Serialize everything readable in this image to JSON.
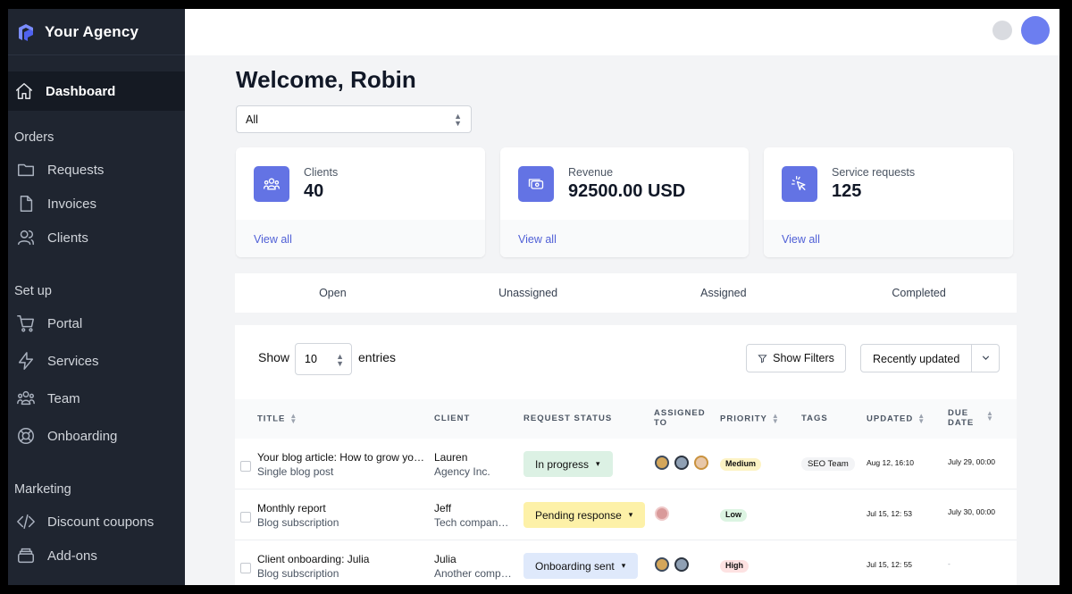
{
  "brand": {
    "name": "Your Agency",
    "logo_icon": "agency-logo-icon"
  },
  "sidebar": {
    "active": {
      "label": "Dashboard",
      "icon": "home-icon"
    },
    "sections": [
      {
        "title": "Orders",
        "items": [
          {
            "label": "Requests",
            "icon": "folder-icon"
          },
          {
            "label": "Invoices",
            "icon": "document-icon"
          },
          {
            "label": "Clients",
            "icon": "users-icon"
          }
        ]
      },
      {
        "title": "Set up",
        "items": [
          {
            "label": "Portal",
            "icon": "cart-icon"
          },
          {
            "label": "Services",
            "icon": "bolt-icon"
          },
          {
            "label": "Team",
            "icon": "team-icon"
          },
          {
            "label": "Onboarding",
            "icon": "lifebuoy-icon"
          }
        ]
      },
      {
        "title": "Marketing",
        "items": [
          {
            "label": "Discount coupons",
            "icon": "code-icon"
          },
          {
            "label": "Add-ons",
            "icon": "layers-icon"
          }
        ]
      }
    ]
  },
  "main": {
    "welcome": "Welcome, Robin",
    "filter_select": "All",
    "cards": [
      {
        "label": "Clients",
        "value": "40",
        "link": "View all",
        "icon": "group-icon"
      },
      {
        "label": "Revenue",
        "value": "92500.00 USD",
        "link": "View all",
        "icon": "cash-icon"
      },
      {
        "label": "Service requests",
        "value": "125",
        "link": "View all",
        "icon": "cursor-click-icon"
      }
    ],
    "tabs": [
      "Open",
      "Unassigned",
      "Assigned",
      "Completed"
    ],
    "table_controls": {
      "show": "Show",
      "entries_value": "10",
      "entries": "entries",
      "filters_button": "Show Filters",
      "sort_button": "Recently updated"
    },
    "columns": {
      "title": "TITLE",
      "client": "CLIENT",
      "status": "REQUEST STATUS",
      "assigned_1": "ASSIGNED",
      "assigned_2": "TO",
      "priority": "PRIORITY",
      "tags": "TAGS",
      "updated": "UPDATED",
      "due_1": "DUE",
      "due_2": "DATE"
    },
    "rows": [
      {
        "title": "Your blog article: How to grow your business",
        "subtitle": "Single blog post",
        "client": "Lauren",
        "client_company": "Agency Inc.",
        "status": "In progress",
        "priority": "Medium",
        "tag": "SEO Team",
        "updated": "Aug 12, 16:10",
        "due": "July 29, 00:00"
      },
      {
        "title": "Monthly report",
        "subtitle": "Blog subscription",
        "client": "Jeff",
        "client_company": "Tech company Ltd.",
        "status": "Pending response",
        "priority": "Low",
        "tag": "",
        "updated": "Jul 15, 12: 53",
        "due": "July 30, 00:00"
      },
      {
        "title": "Client onboarding: Julia",
        "subtitle": "Blog subscription",
        "client": "Julia",
        "client_company": "Another company",
        "status": "Onboarding sent",
        "priority": "High",
        "tag": "",
        "updated": "Jul 15, 12: 55",
        "due": "-"
      }
    ]
  },
  "colors": {
    "accent": "#6373e4",
    "sidebar_bg": "#1f2530",
    "link": "#4f5fd6"
  }
}
